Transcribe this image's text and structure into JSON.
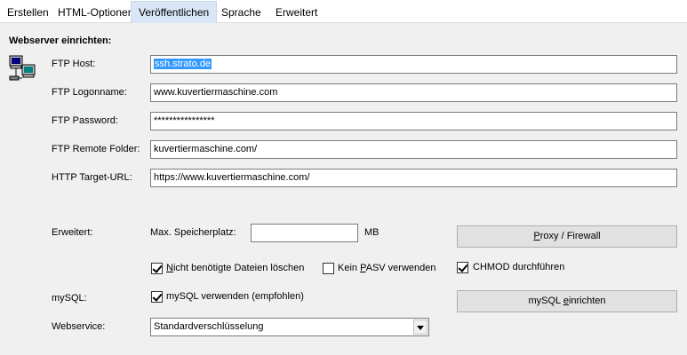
{
  "tabs": [
    {
      "label": "Erstellen"
    },
    {
      "label": "HTML-Optionen"
    },
    {
      "label": "Veröffentlichen"
    },
    {
      "label": "Sprache"
    },
    {
      "label": "Erweitert"
    }
  ],
  "active_tab": "Veröffentlichen",
  "section_title": "Webserver einrichten:",
  "icon": "network-computers-icon",
  "fields": {
    "ftp_host": {
      "label": "FTP Host:",
      "value": "ssh.strato.de"
    },
    "ftp_login": {
      "label": "FTP Logonname:",
      "value": "www.kuvertiermaschine.com"
    },
    "ftp_password": {
      "label": "FTP Password:",
      "value": "****************"
    },
    "ftp_folder": {
      "label": "FTP Remote Folder:",
      "value": "kuvertiermaschine.com/"
    },
    "http_url": {
      "label": "HTTP Target-URL:",
      "value": "https://www.kuvertiermaschine.com/"
    }
  },
  "advanced": {
    "label": "Erweitert:",
    "max_storage_label": "Max. Speicherplatz:",
    "max_storage_value": "",
    "unit": "MB",
    "proxy_button": "Proxy / Firewall",
    "proxy_prefix": "",
    "proxy_mnemonic": "P",
    "proxy_suffix": "roxy / Firewall",
    "cb_delete": {
      "checked": true,
      "pre": "",
      "mn": "N",
      "post": "icht benötigte Dateien löschen"
    },
    "cb_pasv": {
      "checked": false,
      "pre": "Kein ",
      "mn": "P",
      "post": "ASV verwenden"
    },
    "cb_chmod": {
      "checked": true,
      "label": "CHMOD durchführen"
    }
  },
  "mysql": {
    "label": "mySQL:",
    "cb_use": {
      "checked": true,
      "label": "mySQL verwenden (empfohlen)"
    },
    "button_pre": "mySQL ",
    "button_mn": "e",
    "button_post": "inrichten"
  },
  "webservice": {
    "label": "Webservice:",
    "selected": "Standardverschlüsselung"
  },
  "colors": {
    "panel": "#f0f0f0",
    "active_tab": "#d9e6f5",
    "selection": "#3399ff"
  }
}
